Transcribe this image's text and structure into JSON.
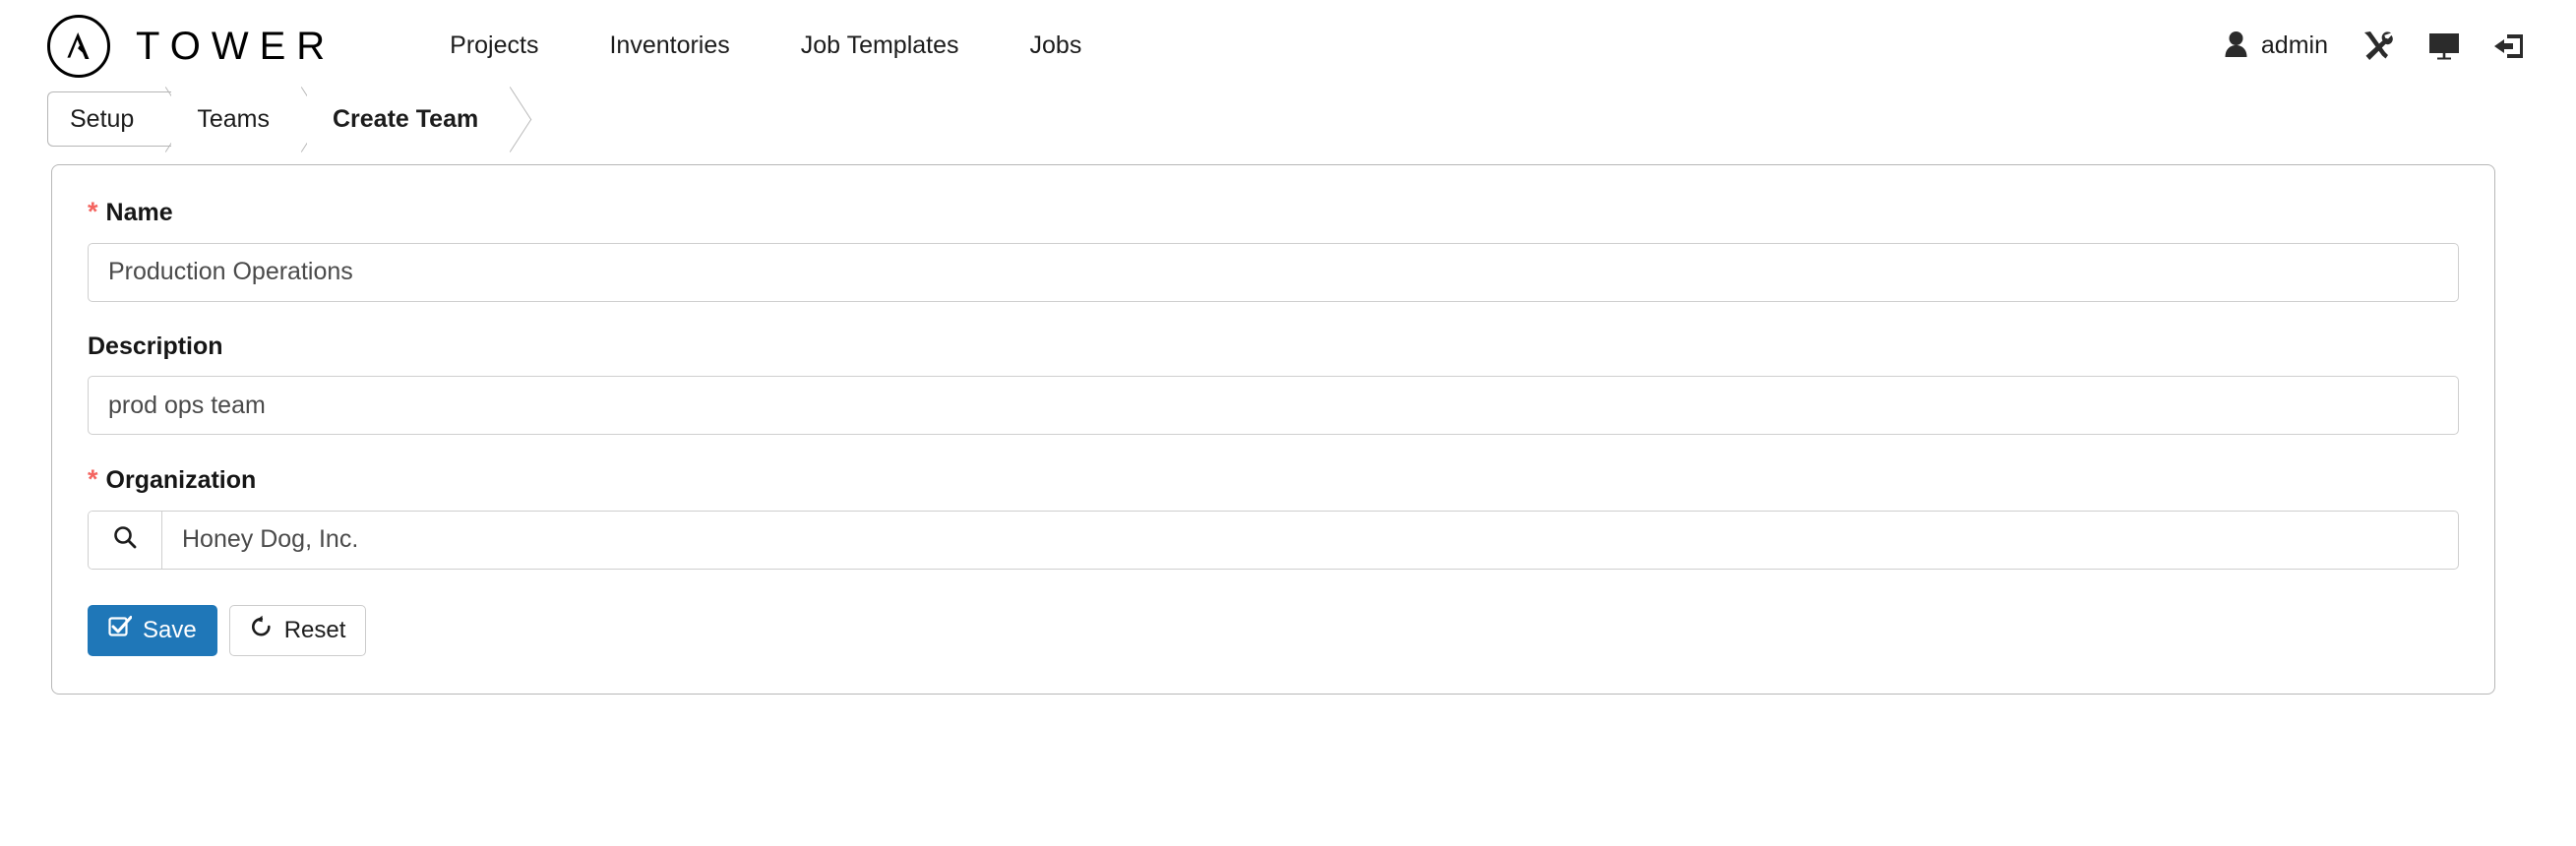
{
  "header": {
    "brand_word": "TOWER",
    "brand_icon": "ansible-logo-icon",
    "nav": [
      {
        "label": "Projects",
        "name": "nav-projects"
      },
      {
        "label": "Inventories",
        "name": "nav-inventories"
      },
      {
        "label": "Job Templates",
        "name": "nav-job-templates"
      },
      {
        "label": "Jobs",
        "name": "nav-jobs"
      }
    ],
    "user": {
      "name": "admin",
      "icon": "user-icon"
    },
    "icons": [
      {
        "name": "wrench-screwdriver-icon",
        "label": "Settings"
      },
      {
        "name": "monitor-icon",
        "label": "View"
      },
      {
        "name": "logout-icon",
        "label": "Logout"
      }
    ]
  },
  "breadcrumb": {
    "items": [
      {
        "label": "Setup",
        "active": false
      },
      {
        "label": "Teams",
        "active": false
      },
      {
        "label": "Create Team",
        "active": true
      }
    ]
  },
  "form": {
    "name": {
      "label": "Name",
      "required": true,
      "required_marker": "*",
      "value": "Production Operations",
      "placeholder": "Name"
    },
    "description": {
      "label": "Description",
      "required": false,
      "value": "prod ops team",
      "placeholder": "Description"
    },
    "organization": {
      "label": "Organization",
      "required": true,
      "required_marker": "*",
      "value": "Honey Dog, Inc.",
      "placeholder": "Organization",
      "search_icon": "search-icon"
    },
    "buttons": {
      "save": {
        "label": "Save",
        "icon": "check-square-icon"
      },
      "reset": {
        "label": "Reset",
        "icon": "undo-arrow-icon"
      }
    }
  },
  "colors": {
    "primary": "#1f77b8",
    "required": "#f4645f",
    "border": "#b7b7b7",
    "input_border": "#cfcfcf",
    "text": "#161616",
    "input_text": "#4a4a4a"
  }
}
